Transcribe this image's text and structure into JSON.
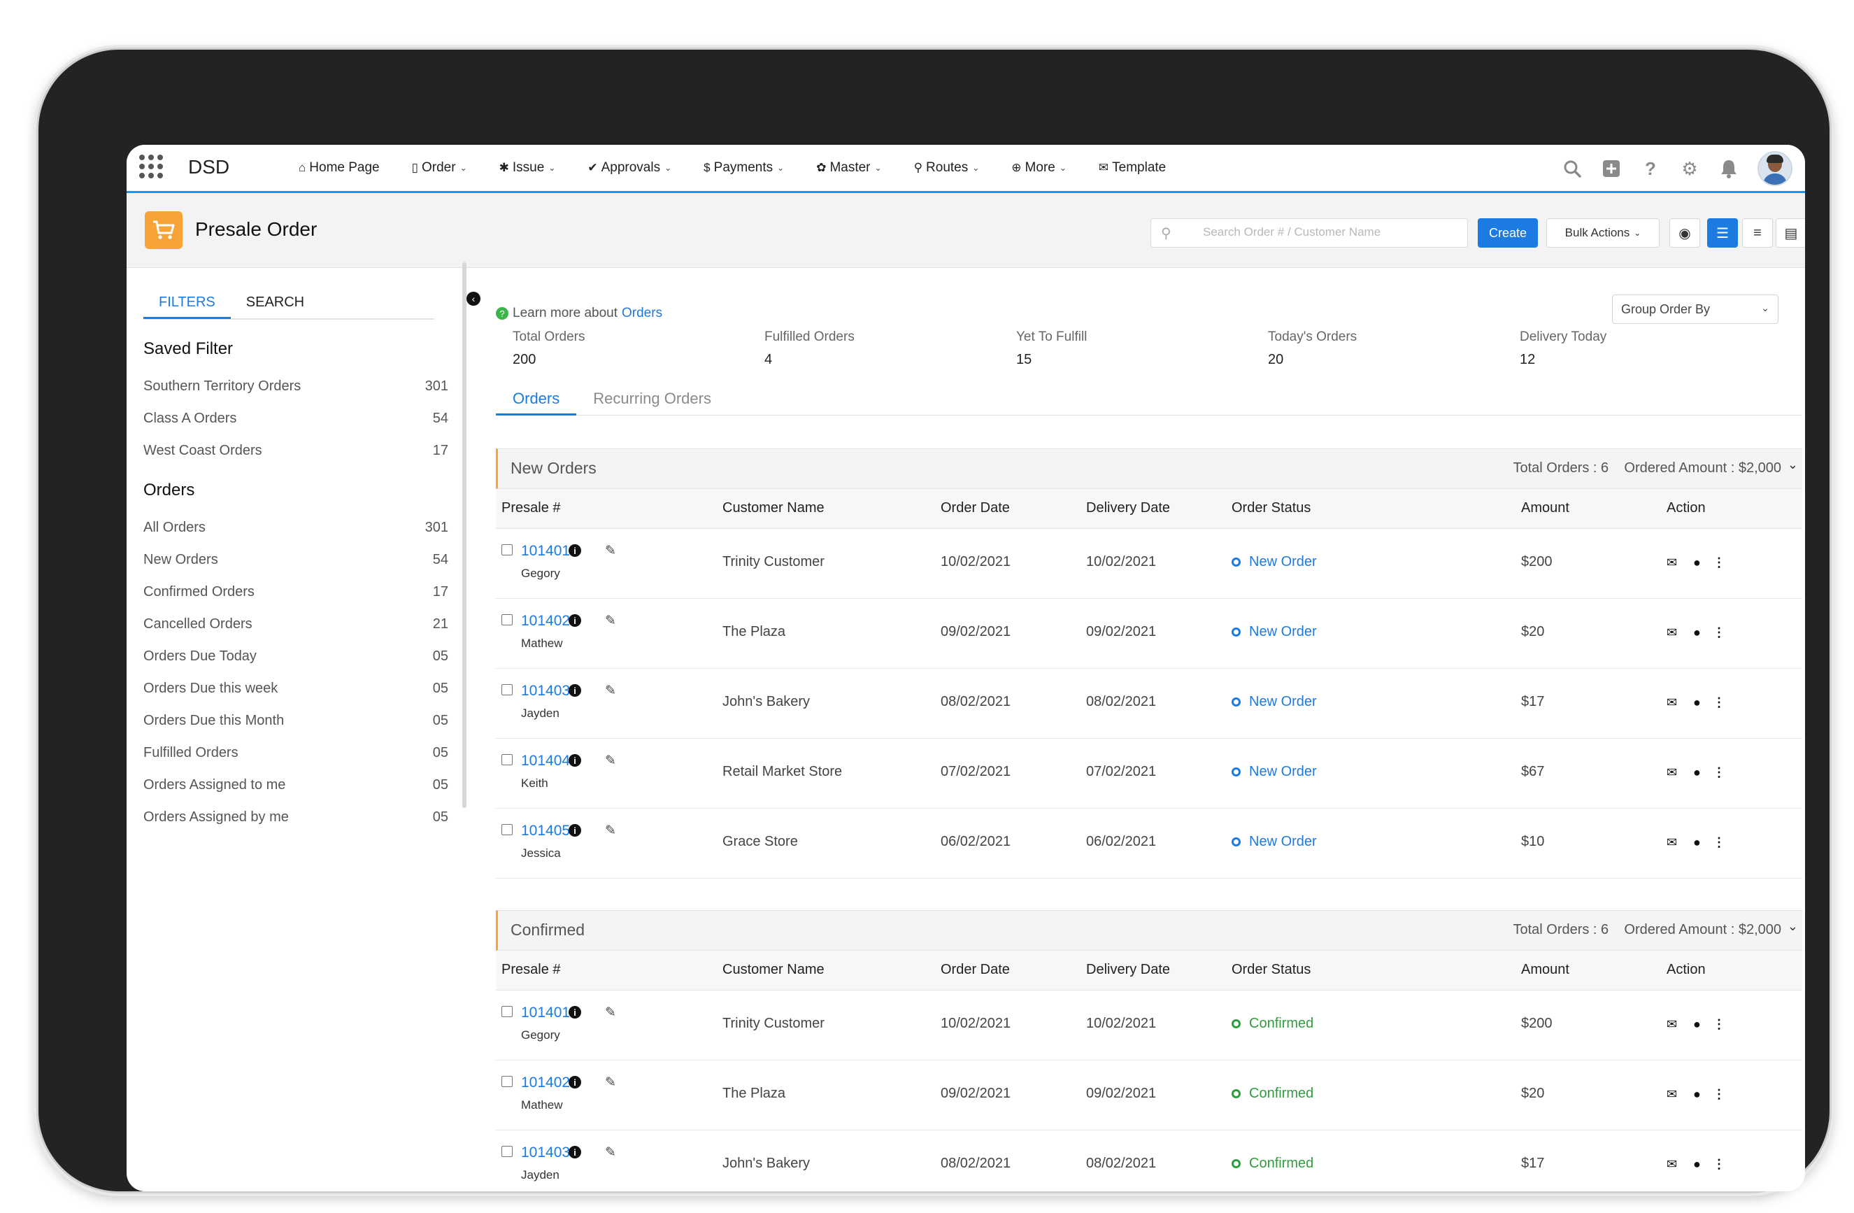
{
  "topnav": {
    "app_name": "DSD",
    "items": [
      {
        "icon": "home-icon",
        "label": "Home Page",
        "chevron": false
      },
      {
        "icon": "document-icon",
        "label": "Order",
        "chevron": true
      },
      {
        "icon": "bug-icon",
        "label": "Issue",
        "chevron": true
      },
      {
        "icon": "check-icon",
        "label": "Approvals",
        "chevron": true
      },
      {
        "icon": "dollar-icon",
        "label": "Payments",
        "chevron": true
      },
      {
        "icon": "cog-icon",
        "label": "Master",
        "chevron": true
      },
      {
        "icon": "map-pin-icon",
        "label": "Routes",
        "chevron": true
      },
      {
        "icon": "plus-circle-icon",
        "label": "More",
        "chevron": true
      },
      {
        "icon": "envelope-icon",
        "label": "Template",
        "chevron": false
      }
    ],
    "right_icons": [
      "search-icon",
      "add-icon",
      "help-icon",
      "settings-icon",
      "bell-icon",
      "avatar"
    ]
  },
  "page": {
    "title": "Presale Order",
    "icon": "cart-icon",
    "search_placeholder": "Search Order # / Customer Name",
    "create_label": "Create",
    "bulk_label": "Bulk Actions"
  },
  "sidebar": {
    "tabs": [
      "FILTERS",
      "SEARCH"
    ],
    "saved_filter_title": "Saved Filter",
    "saved_filters": [
      {
        "label": "Southern Territory Orders",
        "count": "301"
      },
      {
        "label": "Class A Orders",
        "count": "54"
      },
      {
        "label": "West Coast Orders",
        "count": "17"
      }
    ],
    "orders_title": "Orders",
    "orders": [
      {
        "label": "All Orders",
        "count": "301"
      },
      {
        "label": "New Orders",
        "count": "54"
      },
      {
        "label": "Confirmed Orders",
        "count": "17"
      },
      {
        "label": "Cancelled Orders",
        "count": "21"
      },
      {
        "label": "Orders Due Today",
        "count": "05"
      },
      {
        "label": "Orders Due this week",
        "count": "05"
      },
      {
        "label": "Orders Due this Month",
        "count": "05"
      },
      {
        "label": "Fulfilled Orders",
        "count": "05"
      },
      {
        "label": "Orders Assigned to me",
        "count": "05"
      },
      {
        "label": "Orders Assigned by me",
        "count": "05"
      }
    ]
  },
  "main": {
    "learn_text": "Learn more about",
    "learn_link": "Orders",
    "group_by_label": "Group Order By",
    "stats": [
      {
        "label": "Total Orders",
        "value": "200"
      },
      {
        "label": "Fulfilled Orders",
        "value": "4"
      },
      {
        "label": "Yet To Fulfill",
        "value": "15"
      },
      {
        "label": "Today's Orders",
        "value": "20"
      },
      {
        "label": "Delivery Today",
        "value": "12"
      }
    ],
    "tabs": [
      "Orders",
      "Recurring Orders"
    ],
    "columns": [
      "Presale #",
      "Customer Name",
      "Order Date",
      "Delivery Date",
      "Order Status",
      "Amount",
      "Action"
    ],
    "groups": [
      {
        "title": "New Orders",
        "summary": "Total Orders : 6    Ordered Amount : $2,000",
        "rows": [
          {
            "id": "101401",
            "rep": "Gegory",
            "customer": "Trinity Customer",
            "order_date": "10/02/2021",
            "delivery_date": "10/02/2021",
            "status": "New Order",
            "amount": "$200"
          },
          {
            "id": "101402",
            "rep": "Mathew",
            "customer": "The Plaza",
            "order_date": "09/02/2021",
            "delivery_date": "09/02/2021",
            "status": "New Order",
            "amount": "$20"
          },
          {
            "id": "101403",
            "rep": "Jayden",
            "customer": "John's Bakery",
            "order_date": "08/02/2021",
            "delivery_date": "08/02/2021",
            "status": "New Order",
            "amount": "$17"
          },
          {
            "id": "101404",
            "rep": "Keith",
            "customer": "Retail Market Store",
            "order_date": "07/02/2021",
            "delivery_date": "07/02/2021",
            "status": "New Order",
            "amount": "$67"
          },
          {
            "id": "101405",
            "rep": "Jessica",
            "customer": "Grace Store",
            "order_date": "06/02/2021",
            "delivery_date": "06/02/2021",
            "status": "New Order",
            "amount": "$10"
          }
        ]
      },
      {
        "title": "Confirmed",
        "summary": "Total Orders : 6    Ordered Amount : $2,000",
        "rows": [
          {
            "id": "101401",
            "rep": "Gegory",
            "customer": "Trinity Customer",
            "order_date": "10/02/2021",
            "delivery_date": "10/02/2021",
            "status": "Confirmed",
            "amount": "$200"
          },
          {
            "id": "101402",
            "rep": "Mathew",
            "customer": "The Plaza",
            "order_date": "09/02/2021",
            "delivery_date": "09/02/2021",
            "status": "Confirmed",
            "amount": "$20"
          },
          {
            "id": "101403",
            "rep": "Jayden",
            "customer": "John's Bakery",
            "order_date": "08/02/2021",
            "delivery_date": "08/02/2021",
            "status": "Confirmed",
            "amount": "$17"
          }
        ]
      }
    ]
  },
  "colors": {
    "accent": "#1b7be0",
    "nav_underline": "#1b96ff",
    "page_icon": "#f7a336",
    "group_accent": "#f4a636",
    "status_new": "#1b7be0",
    "status_confirmed": "#2e9e3d"
  }
}
